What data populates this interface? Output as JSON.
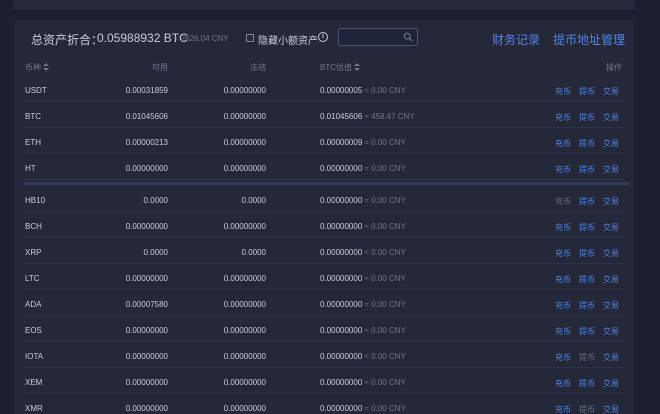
{
  "summary": {
    "label": "总资产折合：",
    "btc_value": "0.05988932 BTC",
    "cny_value": "≈ 2626.04 CNY",
    "hide_small_label": "隐藏小额资产",
    "info_glyph": "i",
    "search_placeholder": "",
    "finance_link": "财务记录",
    "address_link": "提币地址管理"
  },
  "table": {
    "headers": {
      "coin": "币种",
      "available": "可用",
      "frozen": "冻结",
      "btc_value": "BTC估值",
      "actions": "操作"
    },
    "action_labels": {
      "deposit": "充币",
      "withdraw": "提币",
      "trade": "交易"
    },
    "rows_top": [
      {
        "coin": "USDT",
        "available": "0.00031859",
        "frozen": "0.00000000",
        "btc": "0.00000005",
        "cny": "≈ 0.00 CNY"
      },
      {
        "coin": "BTC",
        "available": "0.01045606",
        "frozen": "0.00000000",
        "btc": "0.01045606",
        "cny": "≈ 458.47 CNY"
      },
      {
        "coin": "ETH",
        "available": "0.00000213",
        "frozen": "0.00000000",
        "btc": "0.00000009",
        "cny": "≈ 0.00 CNY"
      },
      {
        "coin": "HT",
        "available": "0.00000000",
        "frozen": "0.00000000",
        "btc": "0.00000000",
        "cny": "≈ 0.00 CNY"
      }
    ],
    "rows_bottom": [
      {
        "coin": "HB10",
        "available": "0.0000",
        "frozen": "0.0000",
        "btc": "0.00000000",
        "cny": "≈ 0.00 CNY"
      },
      {
        "coin": "BCH",
        "available": "0.00000000",
        "frozen": "0.00000000",
        "btc": "0.00000000",
        "cny": "≈ 0.00 CNY"
      },
      {
        "coin": "XRP",
        "available": "0.0000",
        "frozen": "0.0000",
        "btc": "0.00000000",
        "cny": "≈ 0.00 CNY"
      },
      {
        "coin": "LTC",
        "available": "0.00000000",
        "frozen": "0.00000000",
        "btc": "0.00000000",
        "cny": "≈ 0.00 CNY"
      },
      {
        "coin": "ADA",
        "available": "0.00007580",
        "frozen": "0.00000000",
        "btc": "0.00000000",
        "cny": "≈ 0.00 CNY"
      },
      {
        "coin": "EOS",
        "available": "0.00000000",
        "frozen": "0.00000000",
        "btc": "0.00000000",
        "cny": "≈ 0.00 CNY"
      },
      {
        "coin": "IOTA",
        "available": "0.00000000",
        "frozen": "0.00000000",
        "btc": "0.00000000",
        "cny": "≈ 0.00 CNY"
      },
      {
        "coin": "XEM",
        "available": "0.00000000",
        "frozen": "0.00000000",
        "btc": "0.00000000",
        "cny": "≈ 0.00 CNY"
      },
      {
        "coin": "XMR",
        "available": "0.00000000",
        "frozen": "0.00000000",
        "btc": "0.00000000",
        "cny": "≈ 0.00 CNY"
      }
    ]
  },
  "colors": {
    "background": "#1c2030",
    "panel": "#242838",
    "link": "#4f86e8",
    "muted": "#6f7890",
    "text": "#c9ced8"
  }
}
